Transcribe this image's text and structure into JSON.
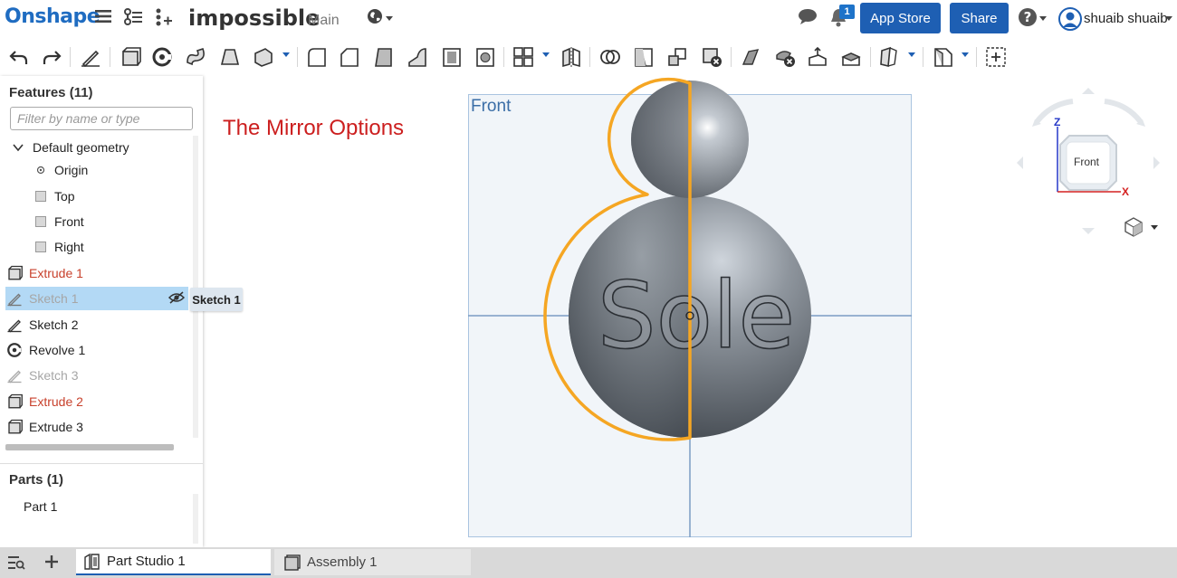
{
  "app": {
    "logo": "Onshape",
    "doc_title": "impossible",
    "branch": "Main"
  },
  "header": {
    "app_store_label": "App Store",
    "share_label": "Share",
    "notification_count": "1",
    "user_name": "shuaib shuaib",
    "help_label": "?"
  },
  "features_panel": {
    "title": "Features (11)",
    "filter_placeholder": "Filter by name or type",
    "items": [
      {
        "label": "Default geometry",
        "icon": "chevron-down-icon",
        "state": "normal"
      },
      {
        "label": "Origin",
        "icon": "origin-icon",
        "state": "normal"
      },
      {
        "label": "Top",
        "icon": "plane-icon",
        "state": "normal"
      },
      {
        "label": "Front",
        "icon": "plane-icon",
        "state": "normal"
      },
      {
        "label": "Right",
        "icon": "plane-icon",
        "state": "normal"
      },
      {
        "label": "Extrude 1",
        "icon": "extrude-icon",
        "state": "error"
      },
      {
        "label": "Sketch 1",
        "icon": "sketch-icon",
        "state": "selected-hidden"
      },
      {
        "label": "Sketch 2",
        "icon": "sketch-icon",
        "state": "normal"
      },
      {
        "label": "Revolve 1",
        "icon": "revolve-icon",
        "state": "normal"
      },
      {
        "label": "Sketch 3",
        "icon": "sketch-icon",
        "state": "hidden"
      },
      {
        "label": "Extrude 2",
        "icon": "extrude-icon",
        "state": "error"
      },
      {
        "label": "Extrude 3",
        "icon": "extrude-icon",
        "state": "normal"
      }
    ],
    "tooltip": "Sketch 1"
  },
  "parts_panel": {
    "title": "Parts (1)",
    "items": [
      "Part 1"
    ]
  },
  "viewport": {
    "annotation": "The Mirror Options",
    "plane_label": "Front",
    "model_text": "Sole",
    "view_cube": {
      "face": "Front",
      "axis_z": "Z",
      "axis_x": "X"
    }
  },
  "tabs": [
    {
      "label": "Part Studio 1",
      "icon": "part-studio-icon",
      "active": true
    },
    {
      "label": "Assembly 1",
      "icon": "assembly-icon",
      "active": false
    }
  ],
  "colors": {
    "accent": "#1e5fb3",
    "error": "#c8412c",
    "highlight": "#f5a623",
    "annotation": "#cc1f1f"
  }
}
